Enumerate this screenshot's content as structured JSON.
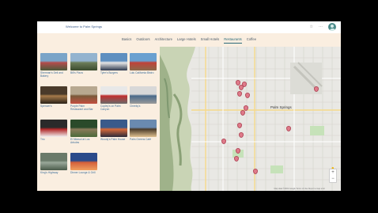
{
  "app": {
    "title": "Welcome to Palm Springs"
  },
  "toolbar": {
    "star_icon": "star-outline-icon",
    "more_icon": "more-horizontal-icon",
    "avatar_icon": "user-avatar-icon"
  },
  "tabs": [
    {
      "label": "Basics"
    },
    {
      "label": "Outdoors"
    },
    {
      "label": "Architecture"
    },
    {
      "label": "Large Hotels"
    },
    {
      "label": "Small Hotels"
    },
    {
      "label": "Restaurants",
      "active": true
    },
    {
      "label": "Coffee"
    }
  ],
  "places": [
    {
      "name": "Sherman's Deli and Bakery"
    },
    {
      "name": "Bill's Pizza"
    },
    {
      "name": "Tyler's Burgers"
    },
    {
      "name": "Lulu California Bistro"
    },
    {
      "name": "Spencer's"
    },
    {
      "name": "Purple Palm Restaurant and Bar"
    },
    {
      "name": "Copley's on Palm Canyon"
    },
    {
      "name": "Cheeky's"
    },
    {
      "name": "Trio"
    },
    {
      "name": "El Mirasol at Los Arboles"
    },
    {
      "name": "Woody's Palm House"
    },
    {
      "name": "Palm Greens Café"
    },
    {
      "name": "King's Highway"
    },
    {
      "name": "Dinner Lounge & Grill"
    }
  ],
  "map": {
    "city_label": "Palm Springs",
    "zoom_in": "+",
    "zoom_out": "−",
    "attribution": "Map data ©2019 Google  Terms of Use  Report a map error",
    "pin_color": "#e07b8a"
  }
}
